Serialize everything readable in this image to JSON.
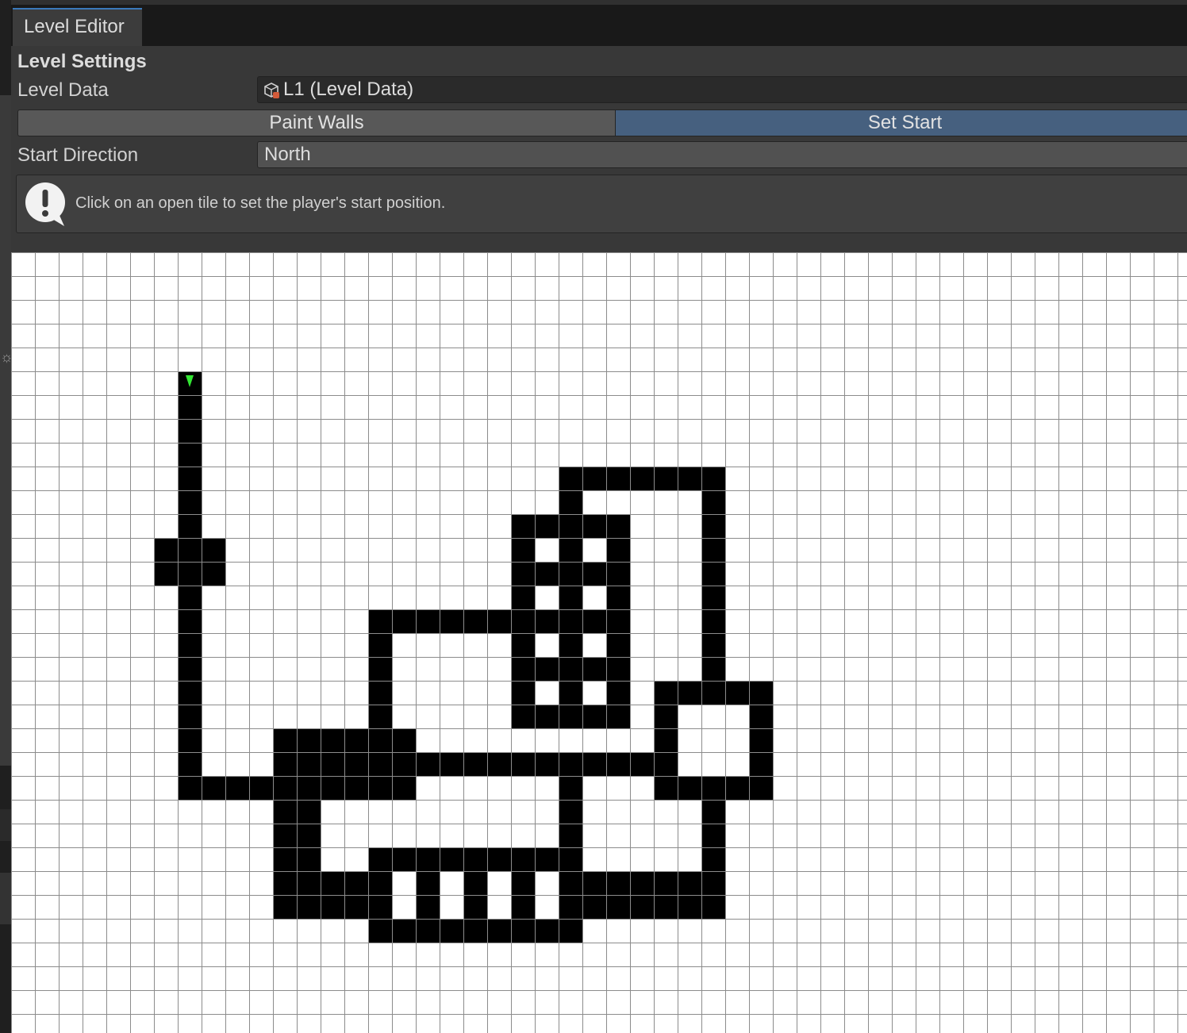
{
  "tab": {
    "title": "Level Editor"
  },
  "settings": {
    "section_title": "Level Settings",
    "level_data_label": "Level Data",
    "level_data_value": "L1 (Level Data)",
    "level_data_icon": "scriptable-object-icon",
    "mode": {
      "options": [
        "Paint Walls",
        "Set Start"
      ],
      "selected": "Set Start"
    },
    "start_direction_label": "Start Direction",
    "start_direction_value": "North"
  },
  "help": {
    "icon": "warning-icon",
    "message": "Click on an open tile to set the player's start position."
  },
  "grid": {
    "columns": 50,
    "rows": 33,
    "wall_color": "#000000",
    "open_color": "#ffffff",
    "line_color": "#8c8c8c",
    "start_marker_color": "#33e633",
    "start_cell": [
      7,
      5
    ],
    "walls": [
      [
        7,
        5,
        7,
        22
      ],
      [
        6,
        12,
        8,
        13
      ],
      [
        8,
        22,
        10,
        22
      ],
      [
        11,
        20,
        16,
        22
      ],
      [
        11,
        23,
        12,
        27
      ],
      [
        13,
        26,
        15,
        27
      ],
      [
        15,
        25,
        23,
        25
      ],
      [
        15,
        26,
        15,
        27
      ],
      [
        17,
        26,
        17,
        27
      ],
      [
        19,
        26,
        19,
        27
      ],
      [
        21,
        26,
        21,
        27
      ],
      [
        23,
        26,
        23,
        27
      ],
      [
        15,
        28,
        23,
        28
      ],
      [
        15,
        15,
        20,
        15
      ],
      [
        15,
        16,
        15,
        19
      ],
      [
        17,
        21,
        27,
        21
      ],
      [
        23,
        9,
        29,
        9
      ],
      [
        23,
        10,
        23,
        19
      ],
      [
        21,
        11,
        25,
        11
      ],
      [
        21,
        12,
        21,
        19
      ],
      [
        25,
        12,
        25,
        19
      ],
      [
        22,
        13,
        24,
        13
      ],
      [
        22,
        15,
        24,
        15
      ],
      [
        22,
        17,
        24,
        17
      ],
      [
        22,
        19,
        24,
        19
      ],
      [
        23,
        22,
        23,
        24
      ],
      [
        29,
        10,
        29,
        17
      ],
      [
        27,
        18,
        31,
        18
      ],
      [
        27,
        19,
        27,
        22
      ],
      [
        31,
        19,
        31,
        22
      ],
      [
        28,
        22,
        30,
        22
      ],
      [
        29,
        23,
        29,
        27
      ],
      [
        24,
        26,
        28,
        27
      ]
    ]
  }
}
